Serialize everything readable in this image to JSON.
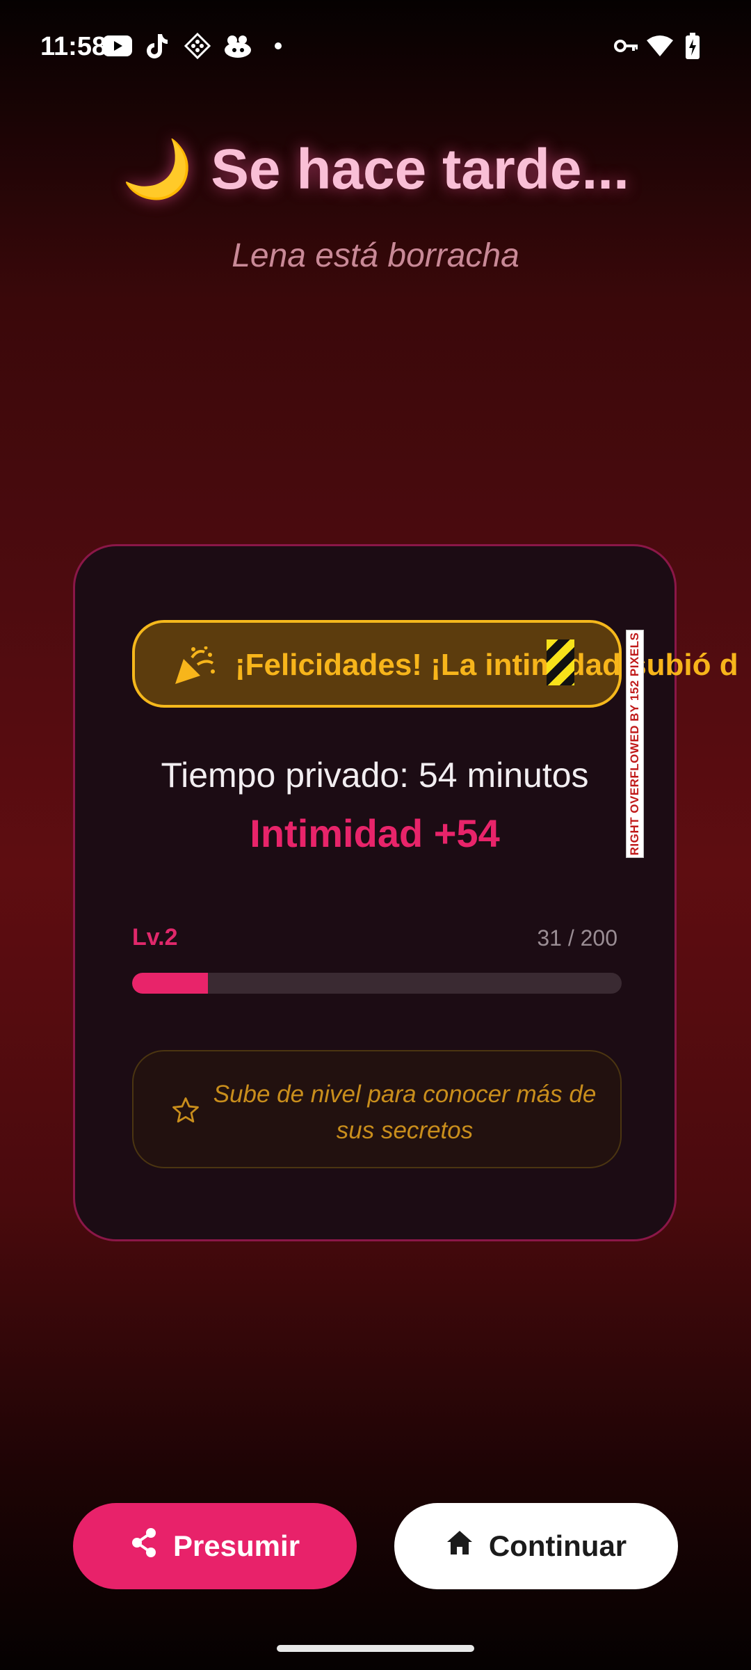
{
  "status_bar": {
    "time": "11:58"
  },
  "header": {
    "emoji": "🌙",
    "title": "Se hace tarde...",
    "subtitle": "Lena está borracha"
  },
  "card": {
    "banner_text": "¡Felicidades! ¡La intimidad subió d",
    "overflow_label": "RIGHT OVERFLOWED BY 152 PIXELS",
    "private_time": "Tiempo privado: 54 minutos",
    "intimacy_gain": "Intimidad +54",
    "level": "Lv.2",
    "progress_text": "31 / 200",
    "progress_fraction": 0.155,
    "hint_text": "Sube de nivel para conocer más de sus secretos"
  },
  "buttons": {
    "share_label": "Presumir",
    "continue_label": "Continuar"
  },
  "colors": {
    "accent_pink": "#e8246a",
    "gold": "#f5b81c",
    "title_pink": "#f9bfd6"
  }
}
